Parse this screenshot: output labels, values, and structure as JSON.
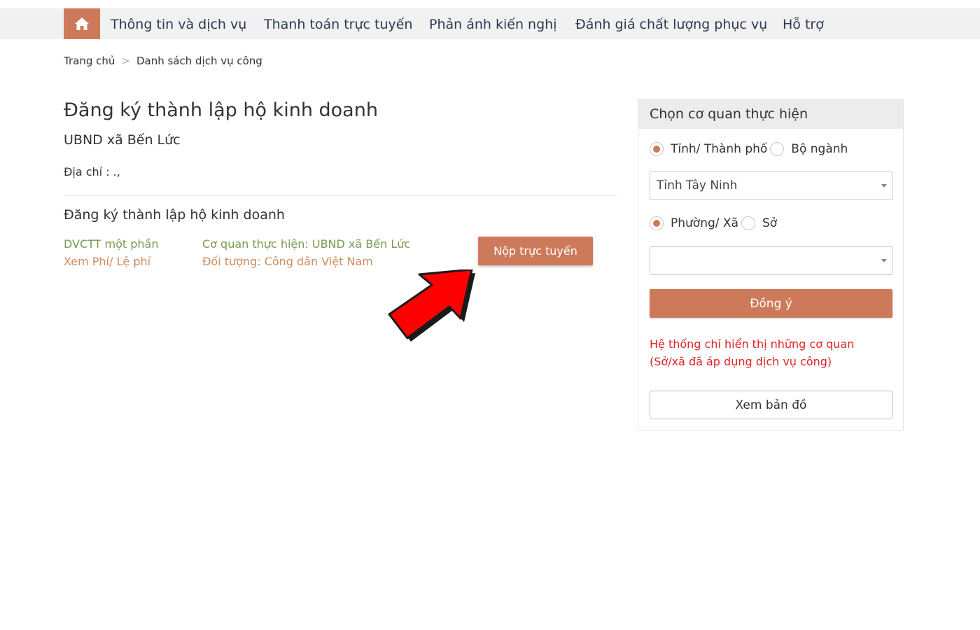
{
  "nav": {
    "home_icon": "home-icon",
    "items": [
      {
        "label": "Thông tin và dịch vụ"
      },
      {
        "label": "Thanh toán trực tuyến"
      },
      {
        "label": "Phản ánh kiến nghị"
      },
      {
        "label": "Đánh giá chất lượng phục vụ"
      },
      {
        "label": "Hỗ trợ"
      }
    ]
  },
  "breadcrumb": {
    "home": "Trang chủ",
    "separator": ">",
    "current": "Danh sách dịch vụ công"
  },
  "main": {
    "title": "Đăng ký thành lập hộ kinh doanh",
    "agency": "UBND xã Bến Lức",
    "address": "Địa chỉ : .,",
    "service": {
      "title": "Đăng ký thành lập hộ kinh doanh",
      "level": "DVCTT một phần",
      "fee_link": "Xem Phí/ Lệ phí",
      "executing_agency": "Cơ quan thực hiện: UBND xã Bến Lức",
      "subject": "Đối tượng: Công dân Việt Nam",
      "submit_label": "Nộp trực tuyến"
    }
  },
  "panel": {
    "title": "Chọn cơ quan thực hiện",
    "level1": {
      "option_a": "Tỉnh/ Thành phố",
      "option_b": "Bộ ngành",
      "selected": "option_a"
    },
    "province_select": {
      "value": "Tỉnh Tây Ninh"
    },
    "level2": {
      "option_a": "Phường/ Xã",
      "option_b": "Sở",
      "selected": "option_a"
    },
    "ward_select": {
      "value": ""
    },
    "agree_label": "Đồng ý",
    "note_line1": "Hệ thống chỉ hiển thị những cơ quan",
    "note_line2": "(Sở/xã đã áp dụng dịch vụ công)",
    "map_label": "Xem bản đồ"
  },
  "colors": {
    "accent": "#cd7a5a",
    "nav_bg": "#f1f1f1",
    "green_text": "#7a9a4e",
    "orange_text": "#d08a5c",
    "note_red": "#dd2222",
    "arrow_red": "#ff0000"
  }
}
